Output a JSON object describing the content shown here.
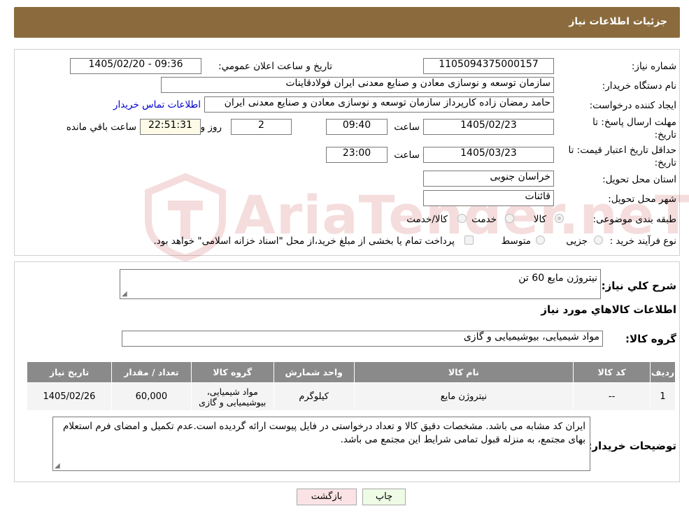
{
  "header": {
    "title": "جزئیات اطلاعات نیاز"
  },
  "watermark": {
    "text": "AriaTender.neT"
  },
  "form": {
    "need_number": {
      "label": "شماره نیاز:",
      "value": "1105094375000157"
    },
    "announce_datetime": {
      "label": "تاریخ و ساعت اعلان عمومي:",
      "value": "1405/02/20 - 09:36"
    },
    "buyer_org": {
      "label": "نام دستگاه خريدار:",
      "value": "سازمان توسعه و نوسازی معادن و صنایع معدنی ایران فولادقاینات"
    },
    "requester": {
      "label": "ايجاد کننده درخواست:",
      "value": "حامد  رمضان زاده  کارپرداز  سازمان توسعه و نوسازی معادن و صنایع معدنی ایران",
      "contact_link": "اطلاعات تماس خریدار"
    },
    "reply_deadline": {
      "label": "مهلت ارسال پاسخ: تا تاریخ:",
      "date": "1405/02/23",
      "time_label": "ساعت",
      "time": "09:40",
      "days": "2",
      "days_label": "روز و",
      "remaining": "22:51:31",
      "remaining_label": "ساعت باقي مانده"
    },
    "price_validity": {
      "label": "حداقل تاریخ اعتبار قیمت: تا تاریخ:",
      "date": "1405/03/23",
      "time_label": "ساعت",
      "time": "23:00"
    },
    "province": {
      "label": "استان محل تحویل:",
      "value": "خراسان جنوبی"
    },
    "city": {
      "label": "شهر محل تحویل:",
      "value": "قائنات"
    },
    "category": {
      "label": "طبقه بندی موضوعی:",
      "options": [
        "کالا",
        "خدمت",
        "کالا/خدمت"
      ],
      "selected": "کالا"
    },
    "purchase_type": {
      "label": "نوع فرآیند خرید :",
      "options": [
        "جزیی",
        "متوسط"
      ],
      "note": "پرداخت تمام یا بخشی از مبلغ خرید،از محل \"اسناد خزانه اسلامی\" خواهد بود."
    }
  },
  "details": {
    "general_desc_label": "شرح کلي نياز:",
    "general_desc_value": "نیتروژن مایع 60 تن",
    "goods_info_title": "اطلاعات کالاهاي مورد نياز",
    "goods_group_label": "گروه کالا:",
    "goods_group_value": "مواد شیمیایی، بیوشیمیایی و  گازی",
    "table": {
      "headers": [
        "رديف",
        "کد کالا",
        "نام کالا",
        "واحد شمارش",
        "گروه کالا",
        "تعداد / مقدار",
        "تاریخ نیاز"
      ],
      "rows": [
        {
          "row": "1",
          "code": "--",
          "name": "نیتروژن مایع",
          "unit": "کیلوگرم",
          "group": "مواد شیمیایی، بیوشیمیایی و گازی",
          "qty": "60,000",
          "date": "1405/02/26"
        }
      ]
    },
    "buyer_notes_label": "توضيحات خريدار:",
    "buyer_notes_value": "ایران کد مشابه می باشد. مشخصات دقیق کالا و تعداد درخواستی در فایل پیوست ارائه گردیده است.عدم تکمیل و امضای فرم استعلام بهای مجتمع، به منزله قبول تمامی شرایط این مجتمع می باشد."
  },
  "buttons": {
    "print": "چاپ",
    "back": "بازگشت"
  },
  "colors": {
    "header_bg": "#8b6b3d",
    "link": "#0000cc",
    "table_header": "#8a8a8a",
    "print_bg": "#eefbe5",
    "back_bg": "#fbe3e5"
  }
}
